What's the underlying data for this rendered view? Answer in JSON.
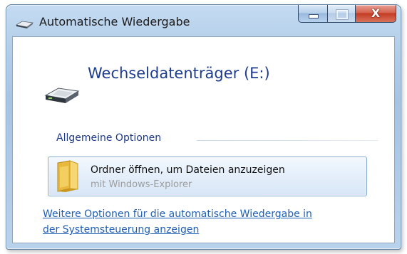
{
  "window": {
    "title": "Automatische Wiedergabe",
    "close_glyph": "X",
    "title_icon": "drive-icon",
    "colors": {
      "frame": "#b3cee9",
      "close_button": "#c43b23",
      "heading": "#1e3d8f",
      "link": "#1f5fb5"
    }
  },
  "main": {
    "drive_title": "Wechseldatenträger (E:)",
    "drive_icon": "removable-drive-icon",
    "section_label": "Allgemeine Optionen",
    "option": {
      "title": "Ordner öffnen, um Dateien anzuzeigen",
      "subtitle": "mit Windows-Explorer",
      "icon": "folder-icon"
    },
    "more_link": {
      "line1": "Weitere Optionen für die automatische Wiedergabe in",
      "line2": "der Systemsteuerung anzeigen"
    }
  }
}
